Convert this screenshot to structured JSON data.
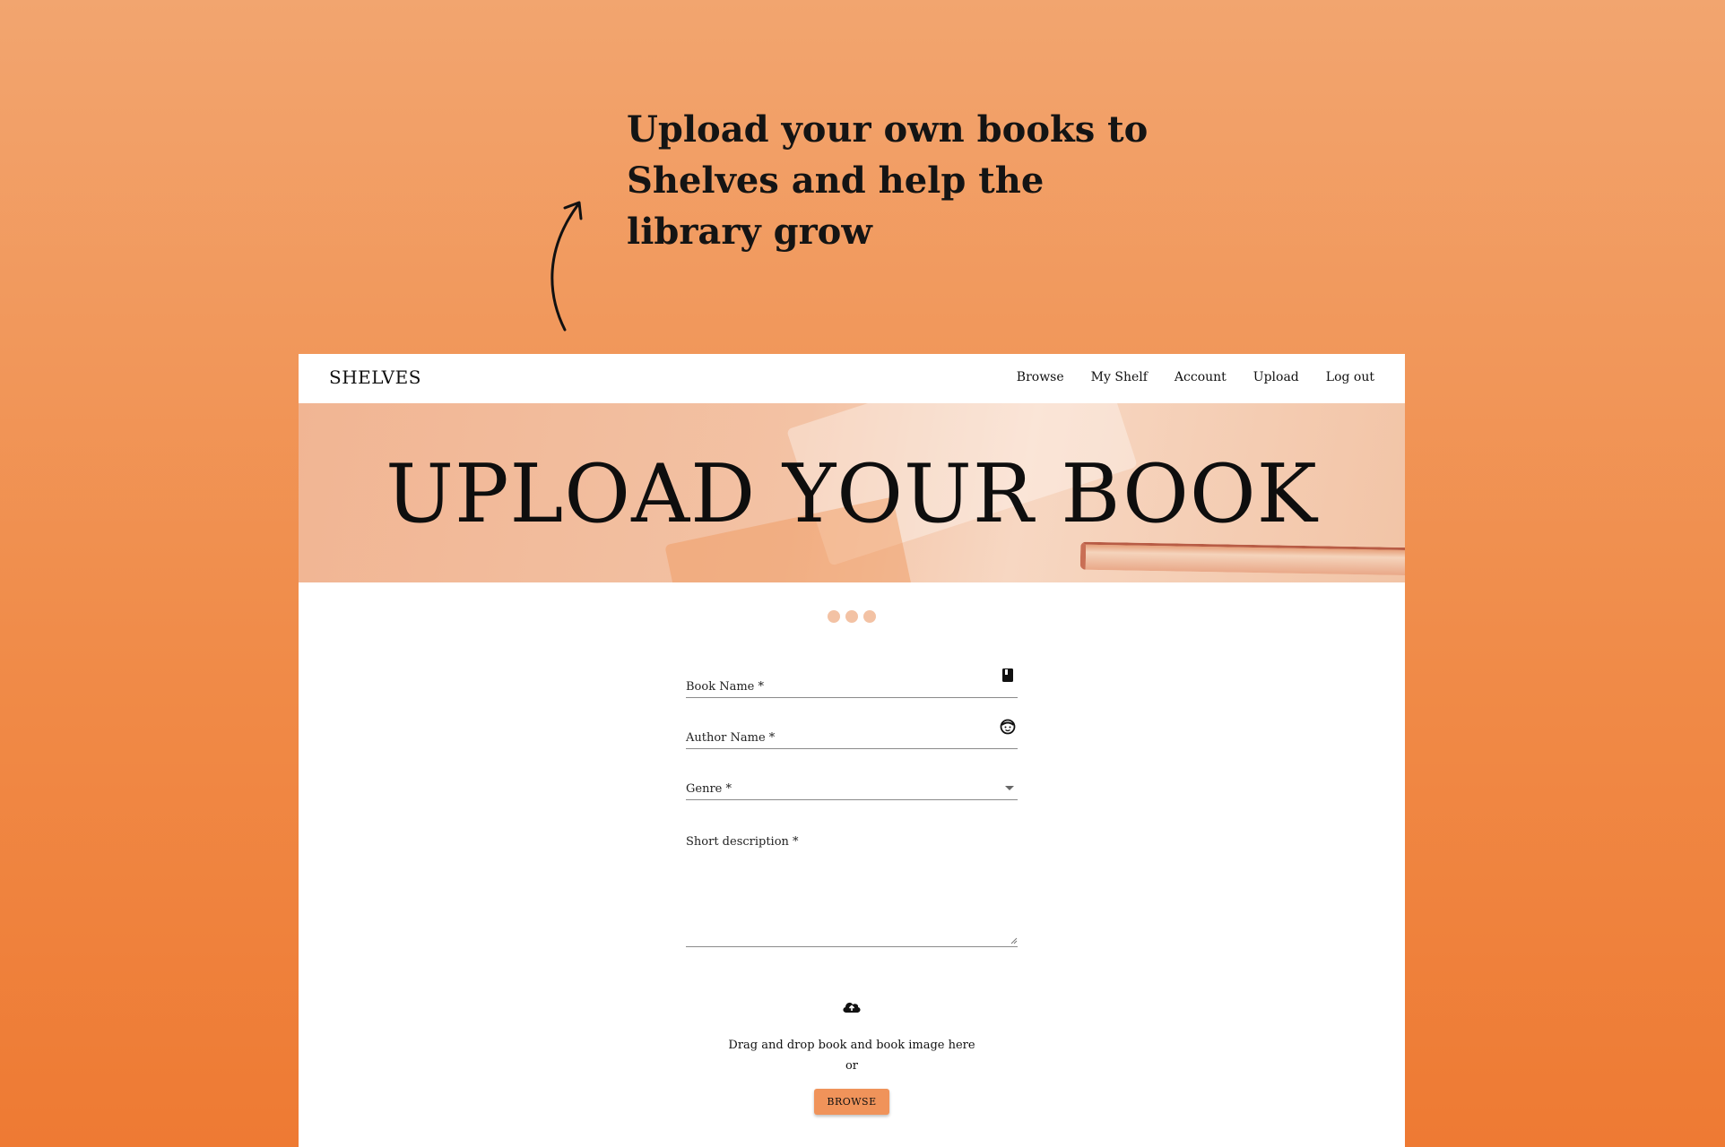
{
  "promo": {
    "heading": "Upload your own books to Shelves and help the library grow"
  },
  "app": {
    "brand": "SHELVES",
    "nav": [
      {
        "label": "Browse"
      },
      {
        "label": "My Shelf"
      },
      {
        "label": "Account"
      },
      {
        "label": "Upload"
      },
      {
        "label": "Log out"
      }
    ],
    "hero_title": "UPLOAD YOUR BOOK",
    "form": {
      "book_name_label": "Book Name *",
      "author_name_label": "Author Name *",
      "genre_label": "Genre *",
      "description_label": "Short description *"
    },
    "dropzone": {
      "line1": "Drag and drop book and book image here",
      "line2": "or",
      "browse_label": "BROWSE"
    }
  },
  "icons": {
    "book": "book-icon",
    "author": "face-icon",
    "genre": "dropdown-caret-icon",
    "upload": "cloud-upload-icon",
    "arrow": "curved-arrow-icon"
  },
  "colors": {
    "background_top": "#f2a56f",
    "background_bottom": "#ee7a33",
    "accent": "#f0935a",
    "dot": "#f3c2a4"
  }
}
